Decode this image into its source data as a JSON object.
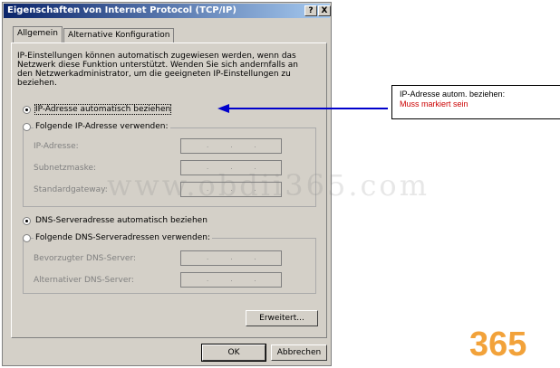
{
  "window": {
    "title": "Eigenschaften von Internet Protocol (TCP/IP)",
    "help_btn": "?",
    "close_btn": "X"
  },
  "tabs": [
    "Allgemein",
    "Alternative Konfiguration"
  ],
  "intro": "IP-Einstellungen können automatisch zugewiesen werden, wenn das Netzwerk diese Funktion unterstützt. Wenden Sie sich andernfalls an den Netzwerkadministrator, um die geeigneten IP-Einstellungen zu beziehen.",
  "ip": {
    "auto_label": "IP-Adresse automatisch beziehen",
    "manual_label": "Folgende IP-Adresse verwenden:",
    "address_label": "IP-Adresse:",
    "subnet_label": "Subnetzmaske:",
    "gateway_label": "Standardgateway:",
    "auto_selected": true
  },
  "dns": {
    "auto_label": "DNS-Serveradresse automatisch beziehen",
    "manual_label": "Folgende DNS-Serveradressen verwenden:",
    "preferred_label": "Bevorzugter DNS-Server:",
    "alternate_label": "Alternativer DNS-Server:",
    "auto_selected": true
  },
  "ip_placeholder": "...",
  "buttons": {
    "advanced": "Erweitert...",
    "ok": "OK",
    "cancel": "Abbrechen"
  },
  "callout": {
    "line1": "IP-Adresse autom. beziehen:",
    "line2": "Muss markiert sein",
    "line2_color": "#cc0000",
    "arrow_color": "#0000cc"
  },
  "watermark": "www.obdii365.com",
  "logo": "365"
}
